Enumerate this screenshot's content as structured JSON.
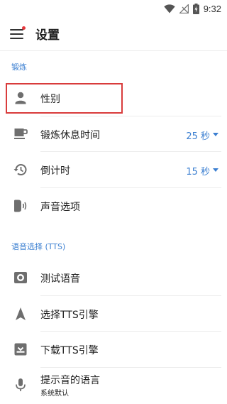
{
  "status_bar": {
    "time": "9:32",
    "icons": [
      "wifi-icon",
      "no-signal-icon",
      "battery-charging-icon"
    ]
  },
  "app_bar": {
    "title": "设置",
    "menu_icon": "menu-icon",
    "has_notification_dot": true
  },
  "sections": {
    "workout": {
      "label": "锻炼",
      "items": {
        "gender": {
          "label": "性别",
          "icon": "person-icon"
        },
        "rest_time": {
          "label": "锻炼休息时间",
          "icon": "coffee-icon",
          "value": "25 秒"
        },
        "countdown": {
          "label": "倒计时",
          "icon": "history-icon",
          "value": "15 秒"
        },
        "sound_options": {
          "label": "声音选项",
          "icon": "sound-icon"
        }
      }
    },
    "tts": {
      "label": "语音选择 (TTS)",
      "items": {
        "test_voice": {
          "label": "测试语音",
          "icon": "speaker-icon"
        },
        "select_engine": {
          "label": "选择TTS引擎",
          "icon": "navigation-icon"
        },
        "download_engine": {
          "label": "下载TTS引擎",
          "icon": "download-box-icon"
        },
        "prompt_language": {
          "label": "提示音的语言",
          "sublabel": "系统默认",
          "icon": "microphone-icon"
        }
      }
    }
  },
  "colors": {
    "accent": "#3b7fd1",
    "highlight_border": "#d93c3c",
    "notification_dot": "#e5373b",
    "icon_gray": "#6e6e6e"
  }
}
